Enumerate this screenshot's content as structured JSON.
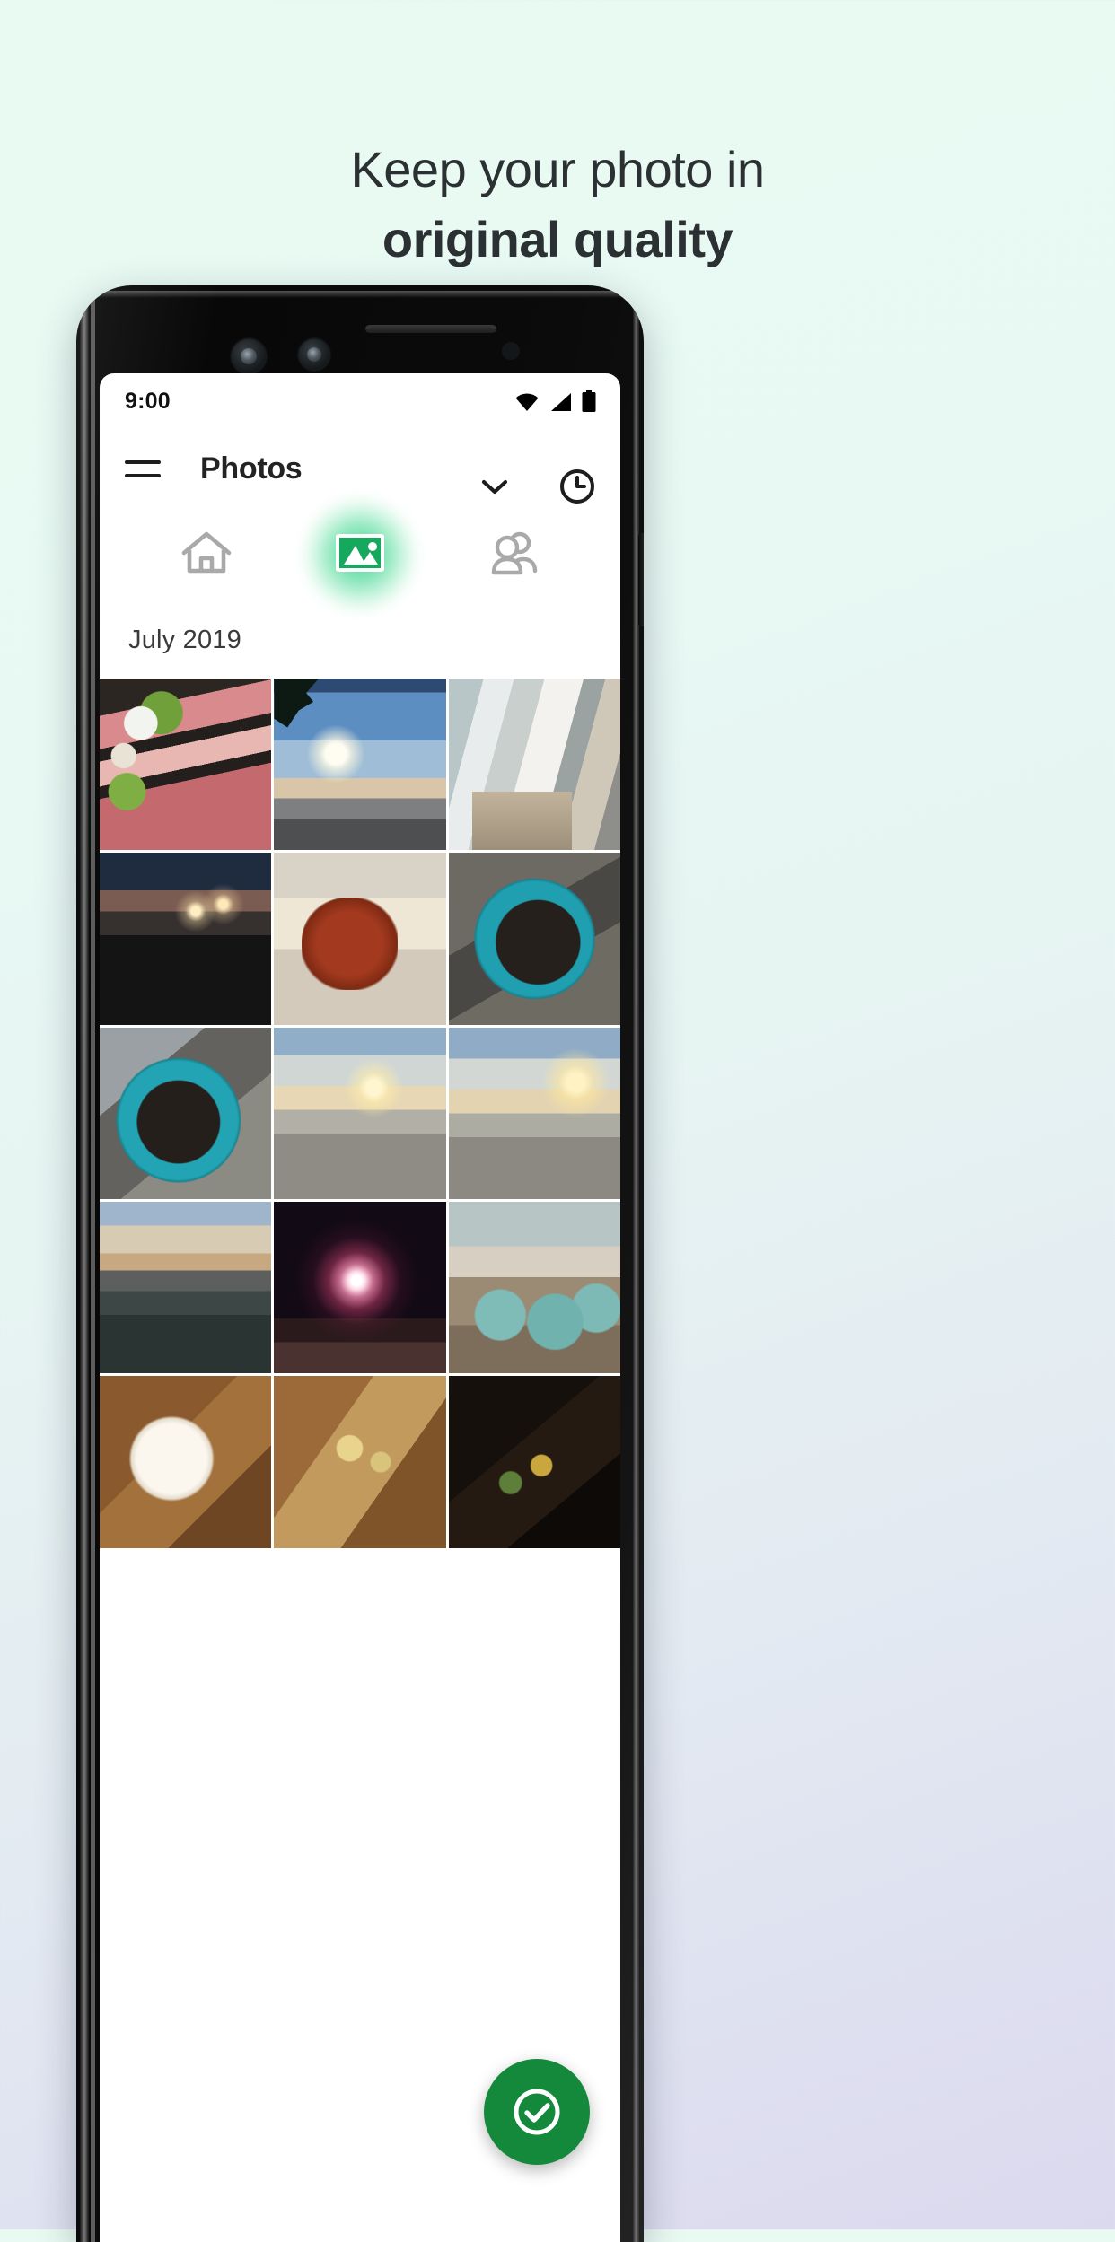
{
  "promo": {
    "headline_line1": "Keep your photo in",
    "headline_line2": "original quality",
    "background_start": "#e9faf2",
    "background_end": "#dcd9ee"
  },
  "phone": {
    "status_bar": {
      "time": "9:00",
      "icons": [
        "wifi-icon",
        "cellular-signal-icon",
        "battery-icon"
      ]
    },
    "app_bar": {
      "menu_icon": "hamburger-menu-icon",
      "title": "Photos",
      "right_icons": [
        "chevron-down-icon",
        "clock-history-icon"
      ]
    },
    "tabs": [
      {
        "name": "home",
        "icon": "home-icon",
        "active": false
      },
      {
        "name": "photos",
        "icon": "image-icon",
        "active": true,
        "accent": "#12b562"
      },
      {
        "name": "sharing",
        "icon": "people-icon",
        "active": false
      }
    ],
    "section_label": "July 2019",
    "fab": {
      "icon": "check-circle-icon",
      "color": "#14893b"
    },
    "grid": {
      "columns": 3,
      "photos": [
        {
          "name": "raw-meat-platter",
          "art": "p-meat"
        },
        {
          "name": "golden-gate-bridge-sun",
          "art": "p-bridge"
        },
        {
          "name": "hallway-with-cat",
          "art": "p-hall"
        },
        {
          "name": "night-highway-drive",
          "art": "p-night"
        },
        {
          "name": "cooked-lobster-plate",
          "art": "p-lobster"
        },
        {
          "name": "teal-planter-seedlings",
          "art": "p-pot"
        },
        {
          "name": "teal-planter-closeup",
          "art": "p-pot2"
        },
        {
          "name": "beach-sunset-bridge",
          "art": "p-beach1"
        },
        {
          "name": "beach-sunset-bridge-alt",
          "art": "p-beach2"
        },
        {
          "name": "lake-dusk-pier",
          "art": "p-lake"
        },
        {
          "name": "fireworks-burst",
          "art": "p-fire"
        },
        {
          "name": "deck-teal-planters",
          "art": "p-deck"
        },
        {
          "name": "wooden-table-bowl",
          "art": "p-bowl"
        },
        {
          "name": "cutting-board-cheese",
          "art": "p-board"
        },
        {
          "name": "dark-dish-closeup",
          "art": "p-dark"
        }
      ]
    }
  }
}
